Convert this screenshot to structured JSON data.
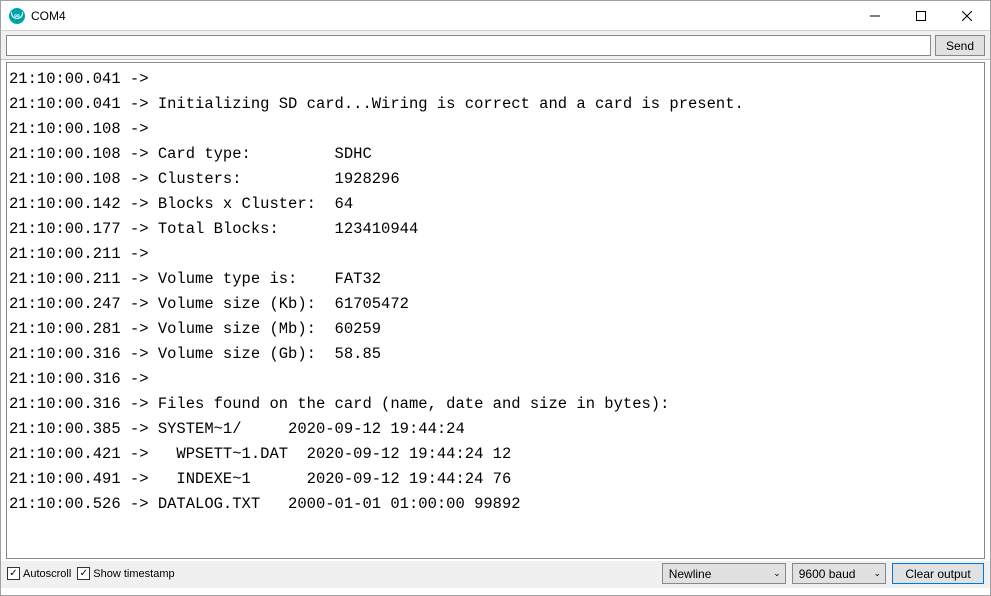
{
  "window": {
    "title": "COM4"
  },
  "toolbar": {
    "input_value": "",
    "send_label": "Send"
  },
  "output_lines": [
    "21:10:00.041 -> ",
    "21:10:00.041 -> Initializing SD card...Wiring is correct and a card is present.",
    "21:10:00.108 -> ",
    "21:10:00.108 -> Card type:         SDHC",
    "21:10:00.108 -> Clusters:          1928296",
    "21:10:00.142 -> Blocks x Cluster:  64",
    "21:10:00.177 -> Total Blocks:      123410944",
    "21:10:00.211 -> ",
    "21:10:00.211 -> Volume type is:    FAT32",
    "21:10:00.247 -> Volume size (Kb):  61705472",
    "21:10:00.281 -> Volume size (Mb):  60259",
    "21:10:00.316 -> Volume size (Gb):  58.85",
    "21:10:00.316 -> ",
    "21:10:00.316 -> Files found on the card (name, date and size in bytes):",
    "21:10:00.385 -> SYSTEM~1/     2020-09-12 19:44:24",
    "21:10:00.421 ->   WPSETT~1.DAT  2020-09-12 19:44:24 12",
    "21:10:00.491 ->   INDEXE~1      2020-09-12 19:44:24 76",
    "21:10:00.526 -> DATALOG.TXT   2000-01-01 01:00:00 99892"
  ],
  "bottom": {
    "autoscroll_label": "Autoscroll",
    "autoscroll_checked": true,
    "timestamp_label": "Show timestamp",
    "timestamp_checked": true,
    "line_ending_selected": "Newline",
    "baud_selected": "9600 baud",
    "clear_label": "Clear output"
  },
  "checkmark": "✓"
}
